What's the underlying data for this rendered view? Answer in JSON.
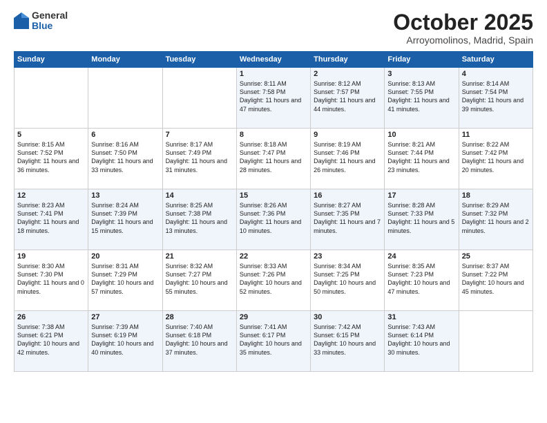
{
  "logo": {
    "general": "General",
    "blue": "Blue"
  },
  "header": {
    "month": "October 2025",
    "location": "Arroyomolinos, Madrid, Spain"
  },
  "weekdays": [
    "Sunday",
    "Monday",
    "Tuesday",
    "Wednesday",
    "Thursday",
    "Friday",
    "Saturday"
  ],
  "weeks": [
    [
      {
        "day": "",
        "content": ""
      },
      {
        "day": "",
        "content": ""
      },
      {
        "day": "",
        "content": ""
      },
      {
        "day": "1",
        "content": "Sunrise: 8:11 AM\nSunset: 7:58 PM\nDaylight: 11 hours and 47 minutes."
      },
      {
        "day": "2",
        "content": "Sunrise: 8:12 AM\nSunset: 7:57 PM\nDaylight: 11 hours and 44 minutes."
      },
      {
        "day": "3",
        "content": "Sunrise: 8:13 AM\nSunset: 7:55 PM\nDaylight: 11 hours and 41 minutes."
      },
      {
        "day": "4",
        "content": "Sunrise: 8:14 AM\nSunset: 7:54 PM\nDaylight: 11 hours and 39 minutes."
      }
    ],
    [
      {
        "day": "5",
        "content": "Sunrise: 8:15 AM\nSunset: 7:52 PM\nDaylight: 11 hours and 36 minutes."
      },
      {
        "day": "6",
        "content": "Sunrise: 8:16 AM\nSunset: 7:50 PM\nDaylight: 11 hours and 33 minutes."
      },
      {
        "day": "7",
        "content": "Sunrise: 8:17 AM\nSunset: 7:49 PM\nDaylight: 11 hours and 31 minutes."
      },
      {
        "day": "8",
        "content": "Sunrise: 8:18 AM\nSunset: 7:47 PM\nDaylight: 11 hours and 28 minutes."
      },
      {
        "day": "9",
        "content": "Sunrise: 8:19 AM\nSunset: 7:46 PM\nDaylight: 11 hours and 26 minutes."
      },
      {
        "day": "10",
        "content": "Sunrise: 8:21 AM\nSunset: 7:44 PM\nDaylight: 11 hours and 23 minutes."
      },
      {
        "day": "11",
        "content": "Sunrise: 8:22 AM\nSunset: 7:42 PM\nDaylight: 11 hours and 20 minutes."
      }
    ],
    [
      {
        "day": "12",
        "content": "Sunrise: 8:23 AM\nSunset: 7:41 PM\nDaylight: 11 hours and 18 minutes."
      },
      {
        "day": "13",
        "content": "Sunrise: 8:24 AM\nSunset: 7:39 PM\nDaylight: 11 hours and 15 minutes."
      },
      {
        "day": "14",
        "content": "Sunrise: 8:25 AM\nSunset: 7:38 PM\nDaylight: 11 hours and 13 minutes."
      },
      {
        "day": "15",
        "content": "Sunrise: 8:26 AM\nSunset: 7:36 PM\nDaylight: 11 hours and 10 minutes."
      },
      {
        "day": "16",
        "content": "Sunrise: 8:27 AM\nSunset: 7:35 PM\nDaylight: 11 hours and 7 minutes."
      },
      {
        "day": "17",
        "content": "Sunrise: 8:28 AM\nSunset: 7:33 PM\nDaylight: 11 hours and 5 minutes."
      },
      {
        "day": "18",
        "content": "Sunrise: 8:29 AM\nSunset: 7:32 PM\nDaylight: 11 hours and 2 minutes."
      }
    ],
    [
      {
        "day": "19",
        "content": "Sunrise: 8:30 AM\nSunset: 7:30 PM\nDaylight: 11 hours and 0 minutes."
      },
      {
        "day": "20",
        "content": "Sunrise: 8:31 AM\nSunset: 7:29 PM\nDaylight: 10 hours and 57 minutes."
      },
      {
        "day": "21",
        "content": "Sunrise: 8:32 AM\nSunset: 7:27 PM\nDaylight: 10 hours and 55 minutes."
      },
      {
        "day": "22",
        "content": "Sunrise: 8:33 AM\nSunset: 7:26 PM\nDaylight: 10 hours and 52 minutes."
      },
      {
        "day": "23",
        "content": "Sunrise: 8:34 AM\nSunset: 7:25 PM\nDaylight: 10 hours and 50 minutes."
      },
      {
        "day": "24",
        "content": "Sunrise: 8:35 AM\nSunset: 7:23 PM\nDaylight: 10 hours and 47 minutes."
      },
      {
        "day": "25",
        "content": "Sunrise: 8:37 AM\nSunset: 7:22 PM\nDaylight: 10 hours and 45 minutes."
      }
    ],
    [
      {
        "day": "26",
        "content": "Sunrise: 7:38 AM\nSunset: 6:21 PM\nDaylight: 10 hours and 42 minutes."
      },
      {
        "day": "27",
        "content": "Sunrise: 7:39 AM\nSunset: 6:19 PM\nDaylight: 10 hours and 40 minutes."
      },
      {
        "day": "28",
        "content": "Sunrise: 7:40 AM\nSunset: 6:18 PM\nDaylight: 10 hours and 37 minutes."
      },
      {
        "day": "29",
        "content": "Sunrise: 7:41 AM\nSunset: 6:17 PM\nDaylight: 10 hours and 35 minutes."
      },
      {
        "day": "30",
        "content": "Sunrise: 7:42 AM\nSunset: 6:15 PM\nDaylight: 10 hours and 33 minutes."
      },
      {
        "day": "31",
        "content": "Sunrise: 7:43 AM\nSunset: 6:14 PM\nDaylight: 10 hours and 30 minutes."
      },
      {
        "day": "",
        "content": ""
      }
    ]
  ]
}
